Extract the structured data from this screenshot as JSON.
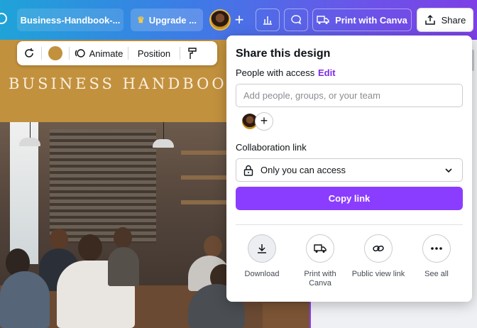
{
  "topbar": {
    "doc_title": "Business-Handbook-...",
    "upgrade_label": "Upgrade ...",
    "print_label": "Print with Canva",
    "share_label": "Share"
  },
  "toolbar": {
    "animate_label": "Animate",
    "position_label": "Position",
    "color": "#c2913e"
  },
  "canvas": {
    "banner_title": "BUSINESS HANDBOOK",
    "banner_color": "#c2913e"
  },
  "share_panel": {
    "title": "Share this design",
    "people_label": "People with access",
    "edit_label": "Edit",
    "add_placeholder": "Add people, groups, or your team",
    "collab_label": "Collaboration link",
    "access_value": "Only you can access",
    "copy_label": "Copy link",
    "actions": [
      {
        "label": "Download",
        "icon": "download-icon"
      },
      {
        "label": "Print with Canva",
        "icon": "truck-icon"
      },
      {
        "label": "Public view link",
        "icon": "link-icon"
      },
      {
        "label": "See all",
        "icon": "more-icon"
      }
    ]
  },
  "colors": {
    "accent": "#8b3dff",
    "edit_link": "#7d2ae8"
  }
}
